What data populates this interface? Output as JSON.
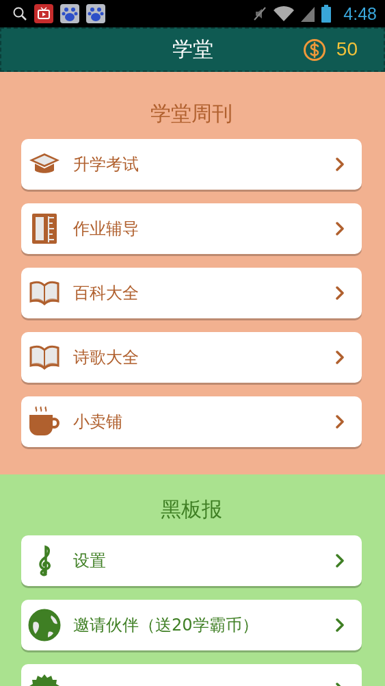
{
  "status_bar": {
    "time": "4:48"
  },
  "header": {
    "title": "学堂",
    "coins": "50"
  },
  "sections": [
    {
      "title": "学堂周刊",
      "color": "#b0602e",
      "items": [
        {
          "label": "升学考试",
          "kind": "cap"
        },
        {
          "label": "作业辅导",
          "kind": "ruler"
        },
        {
          "label": "百科大全",
          "kind": "book"
        },
        {
          "label": "诗歌大全",
          "kind": "book"
        },
        {
          "label": "小卖铺",
          "kind": "cup"
        }
      ]
    },
    {
      "title": "黑板报",
      "color": "#3f7f24",
      "items": [
        {
          "label": "设置",
          "kind": "clef"
        },
        {
          "label": "邀请伙伴（送20学霸币）",
          "kind": "globe"
        },
        {
          "kind": "seal"
        }
      ]
    }
  ]
}
